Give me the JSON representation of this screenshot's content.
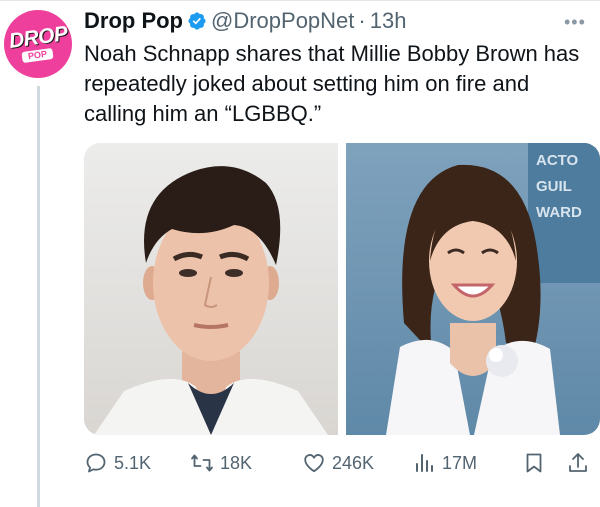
{
  "post": {
    "author_name": "Drop Pop",
    "handle": "@DropPopNet",
    "separator": "·",
    "time": "13h",
    "more_label": "•••",
    "text": "Noah Schnapp shares that Millie Bobby Brown has repeatedly joked about setting him on fire and calling him an “LGBBQ.”"
  },
  "avatar": {
    "logo_top": "DROP",
    "logo_bottom": "POP"
  },
  "media": {
    "backdrop_text": [
      "ACTO",
      "GUIL",
      "WARD"
    ]
  },
  "actions": {
    "replies": "5.1K",
    "reposts": "18K",
    "likes": "246K",
    "views": "17M"
  },
  "colors": {
    "brand": "#ef3f9c",
    "verified": "#1d9bf0",
    "muted": "#536471"
  },
  "icons": [
    "verified-badge-icon",
    "more-icon",
    "reply-icon",
    "repost-icon",
    "like-icon",
    "views-icon",
    "bookmark-icon",
    "share-icon"
  ]
}
